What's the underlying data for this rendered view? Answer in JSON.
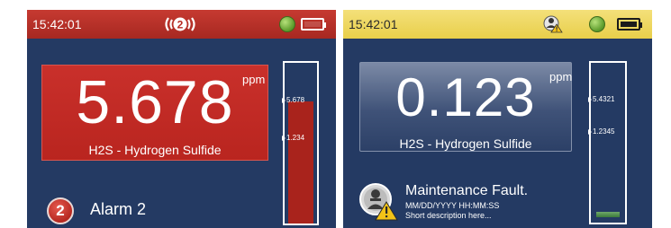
{
  "left_screen": {
    "status": {
      "time": "15:42:01",
      "status_color": "#c63a31"
    },
    "reading": {
      "value": "5.678",
      "unit": "ppm",
      "gas_name": "H2S - Hydrogen Sulfide",
      "box_color": "#c9302b"
    },
    "bar": {
      "upper_label": "5.678",
      "lower_label": "1.234",
      "fill_fraction": 0.76
    },
    "alarm": {
      "badge_number": "2",
      "label": "Alarm 2"
    },
    "icons": {
      "status": "alarm-2-signal-icon",
      "gps": "gps-lock-icon",
      "battery": "battery-icon"
    }
  },
  "right_screen": {
    "status": {
      "time": "15:42:01",
      "status_color": "#e8cf4a"
    },
    "reading": {
      "value": "0.123",
      "unit": "ppm",
      "gas_name": "H2S - Hydrogen Sulfide"
    },
    "bar": {
      "upper_label": "5.4321",
      "lower_label": "1.2345",
      "fill_fraction": 0.03
    },
    "maintenance": {
      "title": "Maintenance Fault.",
      "date_time": "MM/DD/YYYY  HH:MM:SS",
      "description": "Short description here..."
    },
    "icons": {
      "status": "maintenance-warning-icon",
      "gps": "gps-lock-icon",
      "battery": "battery-icon"
    }
  }
}
